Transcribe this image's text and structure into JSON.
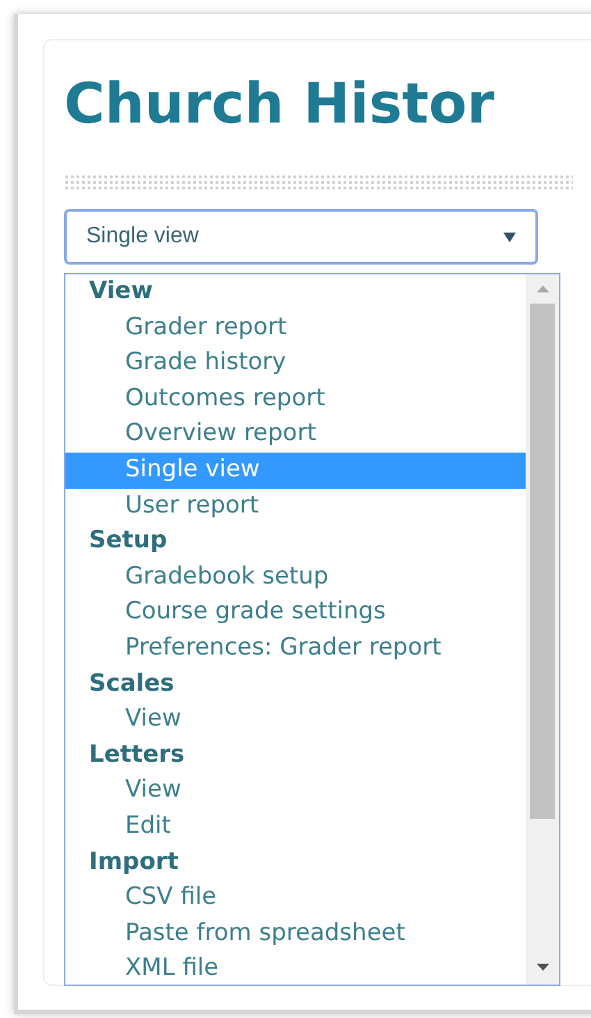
{
  "page": {
    "title": "Church Histor"
  },
  "select": {
    "value": "Single view"
  },
  "dropdown": {
    "groups": [
      {
        "label": "View",
        "options": [
          {
            "label": "Grader report",
            "selected": false
          },
          {
            "label": "Grade history",
            "selected": false
          },
          {
            "label": "Outcomes report",
            "selected": false
          },
          {
            "label": "Overview report",
            "selected": false
          },
          {
            "label": "Single view",
            "selected": true
          },
          {
            "label": "User report",
            "selected": false
          }
        ]
      },
      {
        "label": "Setup",
        "options": [
          {
            "label": "Gradebook setup",
            "selected": false
          },
          {
            "label": "Course grade settings",
            "selected": false
          },
          {
            "label": "Preferences: Grader report",
            "selected": false
          }
        ]
      },
      {
        "label": "Scales",
        "options": [
          {
            "label": "View",
            "selected": false
          }
        ]
      },
      {
        "label": "Letters",
        "options": [
          {
            "label": "View",
            "selected": false
          },
          {
            "label": "Edit",
            "selected": false
          }
        ]
      },
      {
        "label": "Import",
        "options": [
          {
            "label": "CSV file",
            "selected": false
          },
          {
            "label": "Paste from spreadsheet",
            "selected": false
          },
          {
            "label": "XML file",
            "selected": false
          }
        ]
      }
    ]
  }
}
